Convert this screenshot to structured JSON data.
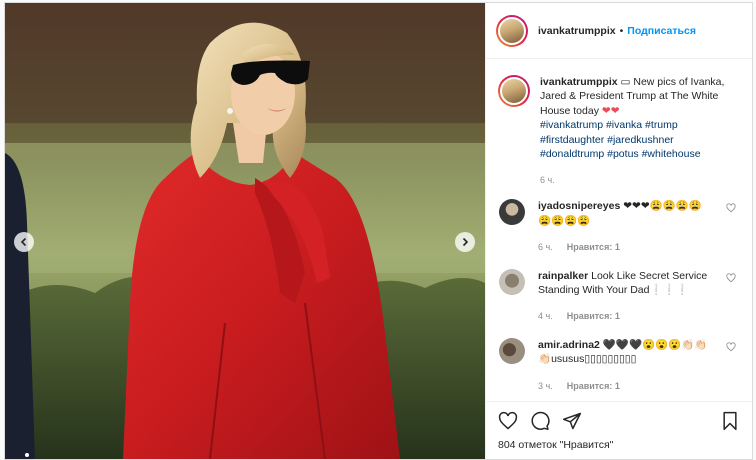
{
  "header": {
    "username": "ivankatrumppix",
    "separator": "•",
    "follow_label": "Подписаться"
  },
  "caption": {
    "username": "ivankatrumppix",
    "emoji_box": "▭",
    "text": "New pics of Ivanka, Jared & President Trump at The White House today",
    "hearts": "❤❤",
    "hashtags": "#ivankatrump #ivanka #trump #firstdaughter #jaredkushner #donaldtrump #potus #whitehouse",
    "time": "6 ч."
  },
  "comments": [
    {
      "username": "iyadosnipereyes",
      "text": "❤❤❤😩😩😩😩😩😩😩😩",
      "time": "6 ч.",
      "like_label": "Нравится: 1"
    },
    {
      "username": "rainpalker",
      "text": "Look Like Secret Service Standing With Your Dad❕❕❕",
      "time": "4 ч.",
      "like_label": "Нравится: 1"
    },
    {
      "username": "amir.adrina2",
      "text": "🖤🖤🖤😮😮😮👏🏻👏🏻👏🏻ususus▯▯▯▯▯▯▯▯▯",
      "time": "3 ч.",
      "like_label": "Нравится: 1"
    }
  ],
  "likes": {
    "text": "804 отметок \"Нравится\""
  },
  "icons": {
    "like": "heart-outline-icon",
    "comment": "speech-bubble-icon",
    "share": "paper-plane-icon",
    "save": "bookmark-icon",
    "prev": "chevron-left-icon",
    "next": "chevron-right-icon"
  },
  "colors": {
    "accent": "#0095f6",
    "hashtag": "#00376b",
    "muted": "#8e8e8e",
    "heart_red": "#ed4956"
  }
}
